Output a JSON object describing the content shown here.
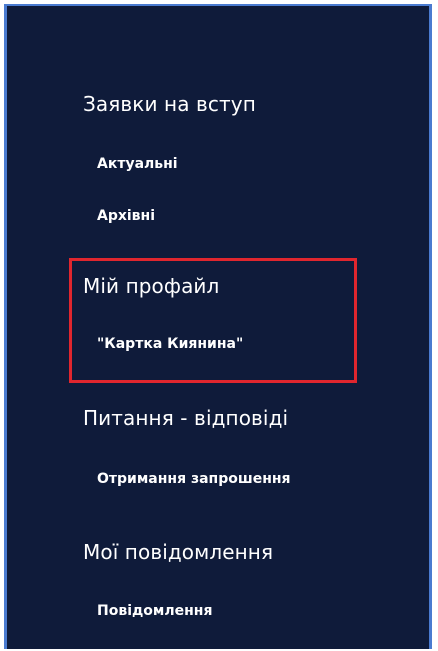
{
  "menu": {
    "sections": [
      {
        "title": "Заявки на вступ",
        "items": [
          "Актуальні",
          "Архівні"
        ]
      },
      {
        "title": "Мій профайл",
        "items": [
          "\"Картка Киянина\""
        ]
      },
      {
        "title": "Питання - відповіді",
        "items": [
          "Отримання запрошення"
        ]
      },
      {
        "title": "Мої повідомлення",
        "items": [
          "Повідомлення"
        ]
      }
    ]
  },
  "colors": {
    "panel_background": "#0f1b3a",
    "panel_border": "#4a7bd0",
    "highlight_border": "#e0262e",
    "text": "#ffffff"
  }
}
